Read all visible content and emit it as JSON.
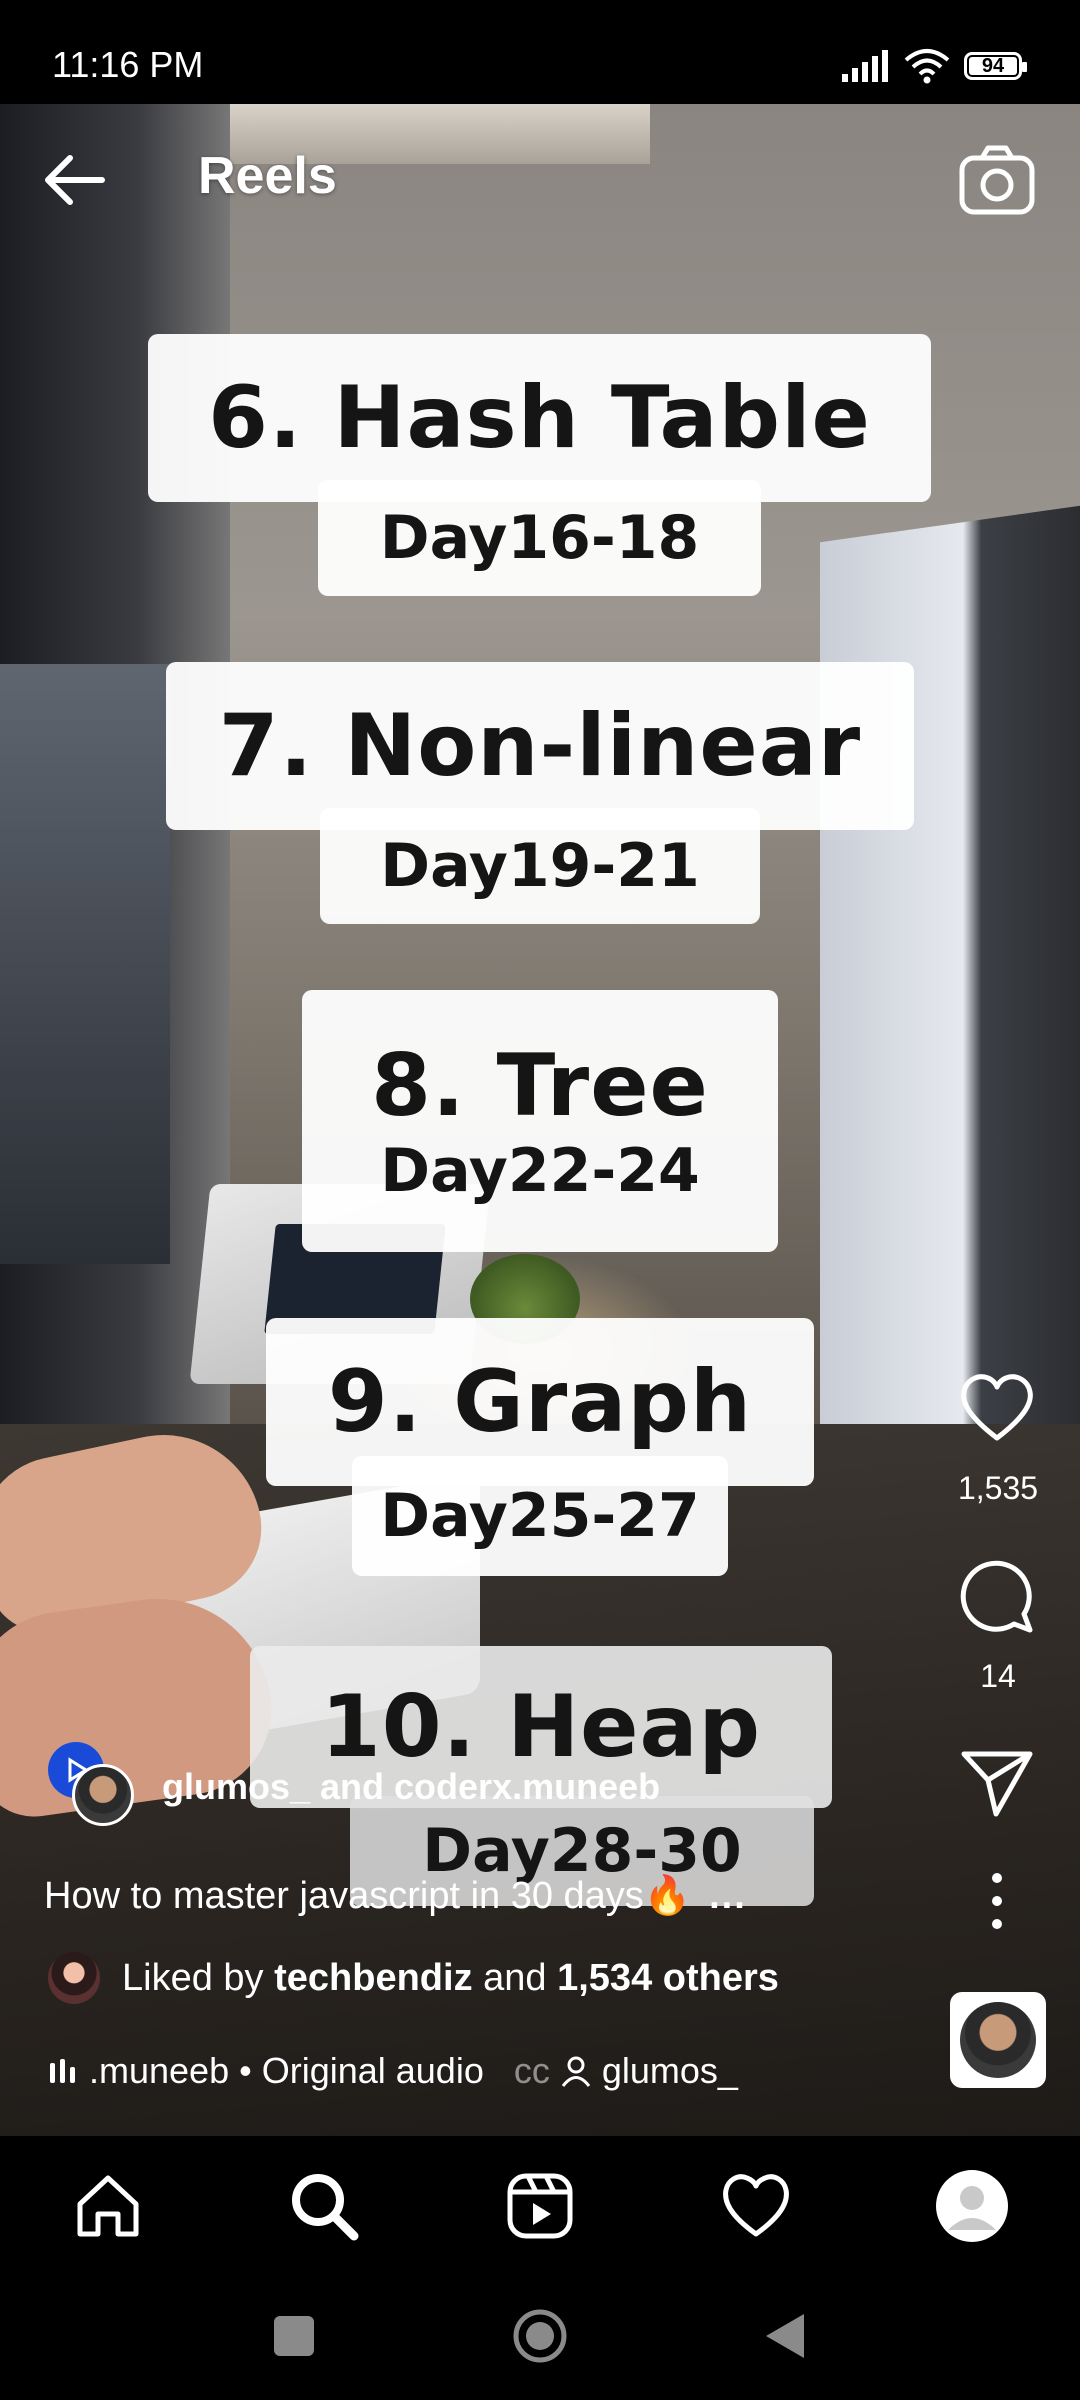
{
  "status_bar": {
    "time": "11:16 PM",
    "battery": "94",
    "battery_level": 0.94
  },
  "header": {
    "title": "Reels",
    "back_icon": "arrow-left-icon",
    "camera_icon": "camera-icon"
  },
  "video_overlay": {
    "items": [
      {
        "title": "6. Hash Table",
        "days": "Day16-18"
      },
      {
        "title": "7. Non-linear",
        "days": "Day19-21"
      },
      {
        "title": "8. Tree",
        "days": "Day22-24"
      },
      {
        "title": "9. Graph",
        "days": "Day25-27"
      },
      {
        "title": "10. Heap",
        "days": "Day28-30"
      }
    ]
  },
  "actions": {
    "like": {
      "icon": "heart-icon",
      "count": "1,535"
    },
    "comment": {
      "icon": "comment-icon",
      "count": "14"
    },
    "share": {
      "icon": "send-icon"
    },
    "more": {
      "icon": "more-vertical-icon"
    }
  },
  "post": {
    "authors": "glumos_ and coderx.muneeb",
    "caption": "How to master javascript in 30 days🔥",
    "caption_more": "...",
    "liked_by_prefix": "Liked by",
    "liked_by_user": "techbendiz",
    "liked_by_and": "and",
    "liked_by_others": "1,534 others",
    "audio_label": ".muneeb • Original audio",
    "audio_fade": "cc",
    "audio_user": "glumos_"
  },
  "bottom_nav": {
    "items": [
      {
        "name": "home",
        "icon": "home-icon"
      },
      {
        "name": "search",
        "icon": "search-icon"
      },
      {
        "name": "reels",
        "icon": "reels-icon"
      },
      {
        "name": "activity",
        "icon": "heart-icon"
      },
      {
        "name": "profile",
        "icon": "profile-avatar-icon"
      }
    ]
  },
  "system_nav": {
    "icons": [
      "recents-square-icon",
      "home-circle-icon",
      "back-triangle-icon"
    ]
  }
}
